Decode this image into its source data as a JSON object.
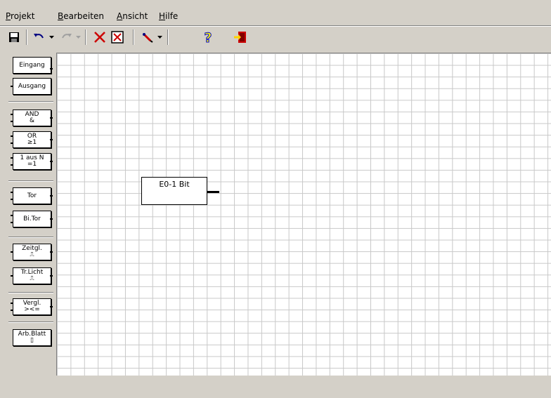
{
  "menu": {
    "items": [
      {
        "accel": "P",
        "rest": "rojekt"
      },
      {
        "accel": "B",
        "rest": "earbeiten"
      },
      {
        "accel": "A",
        "rest": "nsicht"
      },
      {
        "accel": "H",
        "rest": "ilfe"
      }
    ]
  },
  "toolbar": {
    "buttons": [
      {
        "name": "save-button",
        "icon": "floppy-disk-icon"
      },
      {
        "name": "undo-button",
        "icon": "undo-arrow-icon"
      },
      {
        "name": "redo-button",
        "icon": "redo-arrow-icon",
        "disabled": true
      },
      {
        "name": "delete-button",
        "icon": "red-x-icon"
      },
      {
        "name": "delete-all-button",
        "icon": "boxed-x-icon"
      },
      {
        "name": "connect-tool-button",
        "icon": "wire-pen-icon"
      },
      {
        "name": "help-button",
        "icon": "question-mark-icon"
      },
      {
        "name": "exit-button",
        "icon": "exit-door-icon"
      }
    ]
  },
  "palette": {
    "items": [
      {
        "name": "palette-eingang",
        "line1": "Eingang",
        "line2": ""
      },
      {
        "name": "palette-ausgang",
        "line1": "Ausgang",
        "line2": ""
      },
      {
        "name": "palette-and",
        "line1": "AND",
        "line2": "&"
      },
      {
        "name": "palette-or",
        "line1": "OR",
        "line2": "≥1"
      },
      {
        "name": "palette-1ausn",
        "line1": "1 aus N",
        "line2": "=1"
      },
      {
        "name": "palette-tor",
        "line1": "Tor",
        "line2": ""
      },
      {
        "name": "palette-bitor",
        "line1": "Bi.Tor",
        "line2": ""
      },
      {
        "name": "palette-zeitgl",
        "line1": "Zeitgl.",
        "line2": "⎍"
      },
      {
        "name": "palette-trlicht",
        "line1": "Tr.Licht",
        "line2": "⎍"
      },
      {
        "name": "palette-vergl",
        "line1": "Vergl.",
        "line2": "><="
      },
      {
        "name": "palette-arbblatt",
        "line1": "Arb.Blatt",
        "line2": "▯"
      }
    ]
  },
  "canvas": {
    "block_label": "E0-1 Bit"
  },
  "colors": {
    "face": "#d4d0c8",
    "grid": "#c8c8c8",
    "delete_red": "#cc0000",
    "help_blue": "#0000cc",
    "help_yellow": "#ffff00"
  }
}
